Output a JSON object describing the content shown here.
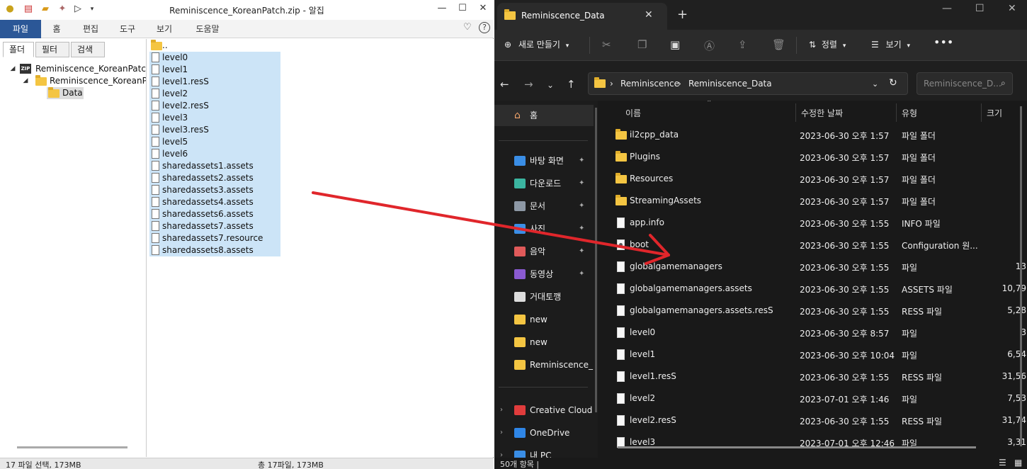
{
  "alzip": {
    "title": "Reminiscence_KoreanPatch.zip - 알집",
    "ribbon_tabs": [
      "파일",
      "홈",
      "편집",
      "도구",
      "보기",
      "도움말"
    ],
    "panel_tabs": [
      "폴더",
      "필터",
      "검색"
    ],
    "tree": {
      "root": "Reminiscence_KoreanPatch.zip",
      "child": "Reminiscence_KoreanPatch",
      "leaf": "Data"
    },
    "parent_dir": "..",
    "files": [
      "level0",
      "level1",
      "level1.resS",
      "level2",
      "level2.resS",
      "level3",
      "level3.resS",
      "level5",
      "level6",
      "sharedassets1.assets",
      "sharedassets2.assets",
      "sharedassets3.assets",
      "sharedassets4.assets",
      "sharedassets6.assets",
      "sharedassets7.assets",
      "sharedassets7.resource",
      "sharedassets8.assets"
    ],
    "status_left": "17 파일 선택, 173MB",
    "status_center": "총 17파일, 173MB"
  },
  "explorer": {
    "tab_title": "Reminiscence_Data",
    "toolbar": {
      "new": "새로 만들기",
      "sort": "정렬",
      "view": "보기"
    },
    "breadcrumb": [
      "Reminiscence",
      "Reminiscence_Data"
    ],
    "search_placeholder": "Reminiscence_D...",
    "nav": {
      "home": "홈",
      "pinned": [
        "바탕 화면",
        "다운로드",
        "문서",
        "사진",
        "음악",
        "동영상"
      ],
      "unpinned": [
        "거대토깽",
        "new",
        "new",
        "Reminiscence_D"
      ],
      "cloud": [
        "Creative Cloud",
        "OneDrive",
        "내 PC"
      ]
    },
    "columns": {
      "name": "이름",
      "modified": "수정한 날짜",
      "type": "유형",
      "size": "크기"
    },
    "rows": [
      {
        "name": "il2cpp_data",
        "date": "2023-06-30 오후 1:57",
        "type": "파일 폴더",
        "size": "",
        "kind": "folder"
      },
      {
        "name": "Plugins",
        "date": "2023-06-30 오후 1:57",
        "type": "파일 폴더",
        "size": "",
        "kind": "folder"
      },
      {
        "name": "Resources",
        "date": "2023-06-30 오후 1:57",
        "type": "파일 폴더",
        "size": "",
        "kind": "folder"
      },
      {
        "name": "StreamingAssets",
        "date": "2023-06-30 오후 1:57",
        "type": "파일 폴더",
        "size": "",
        "kind": "folder"
      },
      {
        "name": "app.info",
        "date": "2023-06-30 오후 1:55",
        "type": "INFO 파일",
        "size": "",
        "kind": "file"
      },
      {
        "name": "boot",
        "date": "2023-06-30 오후 1:55",
        "type": "Configuration 원...",
        "size": "",
        "kind": "cfg"
      },
      {
        "name": "globalgamemanagers",
        "date": "2023-06-30 오후 1:55",
        "type": "파일",
        "size": "13",
        "kind": "file"
      },
      {
        "name": "globalgamemanagers.assets",
        "date": "2023-06-30 오후 1:55",
        "type": "ASSETS 파일",
        "size": "10,79",
        "kind": "file"
      },
      {
        "name": "globalgamemanagers.assets.resS",
        "date": "2023-06-30 오후 1:55",
        "type": "RESS 파일",
        "size": "5,28",
        "kind": "file"
      },
      {
        "name": "level0",
        "date": "2023-06-30 오후 8:57",
        "type": "파일",
        "size": "3",
        "kind": "file"
      },
      {
        "name": "level1",
        "date": "2023-06-30 오후 10:04",
        "type": "파일",
        "size": "6,54",
        "kind": "file"
      },
      {
        "name": "level1.resS",
        "date": "2023-06-30 오후 1:55",
        "type": "RESS 파일",
        "size": "31,56",
        "kind": "file"
      },
      {
        "name": "level2",
        "date": "2023-07-01 오후 1:46",
        "type": "파일",
        "size": "7,53",
        "kind": "file"
      },
      {
        "name": "level2.resS",
        "date": "2023-06-30 오후 1:55",
        "type": "RESS 파일",
        "size": "31,74",
        "kind": "file"
      },
      {
        "name": "level3",
        "date": "2023-07-01 오후 12:46",
        "type": "파일",
        "size": "3,31",
        "kind": "file"
      }
    ],
    "status": "50개 항목  |"
  },
  "colors": {
    "alzip_accent": "#2b5797",
    "selection": "#cce4f7",
    "folder": "#f4c542",
    "arrow": "#e0262b",
    "explorer_bg": "#191919"
  }
}
